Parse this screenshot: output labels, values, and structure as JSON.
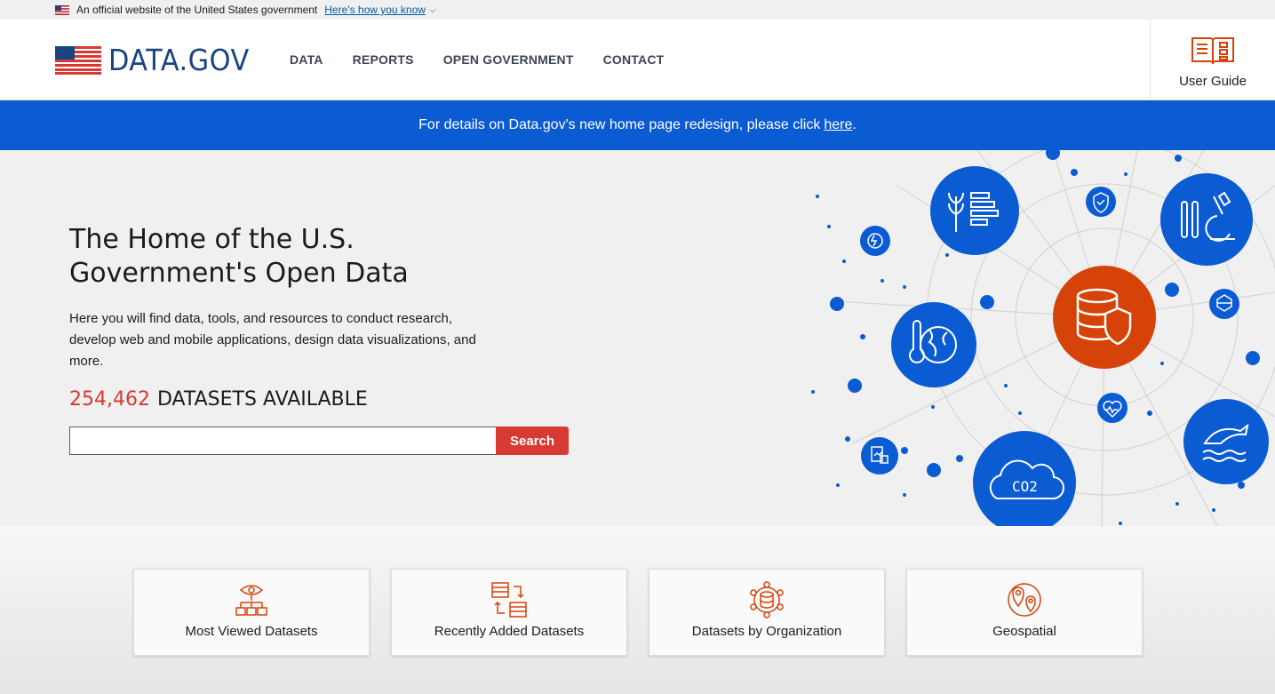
{
  "gov_banner": {
    "text": "An official website of the United States government",
    "link": "Here's how you know"
  },
  "header": {
    "logo": "DATA.GOV",
    "nav": [
      "DATA",
      "REPORTS",
      "OPEN GOVERNMENT",
      "CONTACT"
    ],
    "user_guide": "User Guide"
  },
  "alert": {
    "text": "For details on Data.gov's new home page redesign, please click",
    "link": "here",
    "suffix": "."
  },
  "hero": {
    "title": "The Home of the U.S. Government's Open Data",
    "description": "Here you will find data, tools, and resources to conduct research, develop web and mobile applications, design data visualizations, and more.",
    "dataset_count": "254,462",
    "dataset_label": "DATASETS AVAILABLE",
    "search_value": "",
    "search_button": "Search",
    "graphic_label": "CO2"
  },
  "cards": [
    {
      "label": "Most Viewed Datasets",
      "icon": "eye-hierarchy-icon"
    },
    {
      "label": "Recently Added Datasets",
      "icon": "datasets-arrows-icon"
    },
    {
      "label": "Datasets by Organization",
      "icon": "database-network-icon"
    },
    {
      "label": "Geospatial",
      "icon": "map-pin-icon"
    }
  ],
  "colors": {
    "brand_blue": "#1a4480",
    "alert_blue": "#0b5bd3",
    "accent_red": "#d83933",
    "icon_orange": "#d54309",
    "circle_blue": "#0b5bd3"
  }
}
